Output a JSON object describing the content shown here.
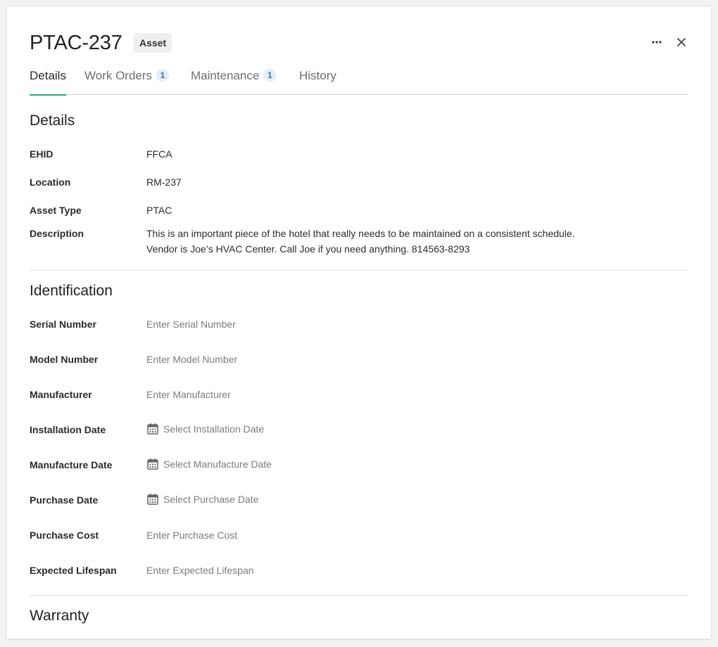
{
  "header": {
    "title": "PTAC-237",
    "badge": "Asset",
    "more_icon": "more-horizontal-icon",
    "close_icon": "close-icon"
  },
  "tabs": [
    {
      "label": "Details",
      "active": true
    },
    {
      "label": "Work Orders",
      "count": "1"
    },
    {
      "label": "Maintenance",
      "count": "1"
    },
    {
      "label": "History"
    }
  ],
  "details": {
    "title": "Details",
    "ehid": {
      "label": "EHID",
      "value": "FFCA"
    },
    "location": {
      "label": "Location",
      "value": "RM-237"
    },
    "asset_type": {
      "label": "Asset Type",
      "value": "PTAC"
    },
    "description": {
      "label": "Description",
      "line1": "This is an important piece of the hotel that really needs to be maintained on a consistent schedule.",
      "line2": "Vendor is Joe’s HVAC Center. Call Joe if you need anything. 814563-8293"
    }
  },
  "identification": {
    "title": "Identification",
    "serial_number": {
      "label": "Serial Number",
      "placeholder": "Enter Serial Number"
    },
    "model_number": {
      "label": "Model Number",
      "placeholder": "Enter Model Number"
    },
    "manufacturer": {
      "label": "Manufacturer",
      "placeholder": "Enter Manufacturer"
    },
    "installation_date": {
      "label": "Installation Date",
      "placeholder": "Select Installation Date"
    },
    "manufacture_date": {
      "label": "Manufacture Date",
      "placeholder": "Select Manufacture Date"
    },
    "purchase_date": {
      "label": "Purchase Date",
      "placeholder": "Select Purchase Date"
    },
    "purchase_cost": {
      "label": "Purchase Cost",
      "placeholder": "Enter Purchase Cost"
    },
    "expected_lifespan": {
      "label": "Expected Lifespan",
      "placeholder": "Enter Expected Lifespan"
    }
  },
  "warranty": {
    "title": "Warranty"
  },
  "colors": {
    "accent": "#2aa585",
    "badge_bg": "#efefef",
    "count_bg": "#e3eef9",
    "count_text": "#3672b8",
    "placeholder": "#7c7c7c",
    "divider": "#dedede"
  }
}
